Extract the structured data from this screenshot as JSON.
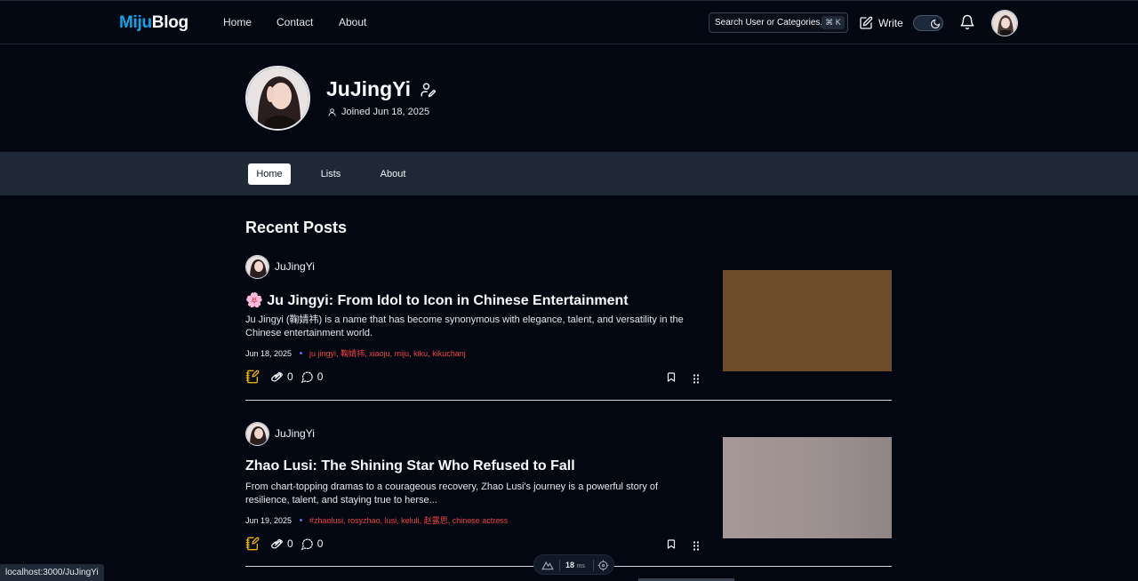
{
  "topnav": {
    "logo_part1": "Miju",
    "logo_part2": "Blog",
    "links": {
      "home": "Home",
      "contact": "Contact",
      "about": "About"
    },
    "search_placeholder": "Search User or Categories...",
    "search_shortcut": "⌘ K",
    "write_label": "Write"
  },
  "profile": {
    "name": "JuJingYi",
    "joined": "Joined Jun 18, 2025"
  },
  "tabs": {
    "home": "Home",
    "lists": "Lists",
    "about": "About",
    "active": "Home"
  },
  "section_title": "Recent Posts",
  "posts": [
    {
      "author": "JuJingYi",
      "title": "🌸 Ju Jingyi: From Idol to Icon in Chinese Entertainment",
      "excerpt": "Ju Jingyi (鞠婧祎) is a name that has become synonymous with elegance, talent, and versatility in the Chinese entertainment world.",
      "date": "Jun 18, 2025",
      "tags": [
        "ju jingyi",
        "鞠婧祎",
        "xiaoju",
        "miju",
        "kiku",
        "kikuchanj"
      ],
      "claps": "0",
      "comments": "0",
      "thumb_color": "#6e4c2b"
    },
    {
      "author": "JuJingYi",
      "title": "Zhao Lusi: The Shining Star Who Refused to Fall",
      "excerpt": "From chart-topping dramas to a courageous recovery, Zhao Lusi's journey is a powerful story of resilience, talent, and staying true to herse...",
      "date": "Jun 19, 2025",
      "tags": [
        "#zhaolusi",
        "rosyzhao",
        "lusi",
        "keluli",
        "赵露思",
        "chinese actress"
      ],
      "claps": "0",
      "comments": "0",
      "thumb_color": "#9b8f8f"
    }
  ],
  "status_url": "localhost:3000/JuJingYi",
  "devbar": {
    "ms_value": "18",
    "ms_unit": "ms"
  }
}
